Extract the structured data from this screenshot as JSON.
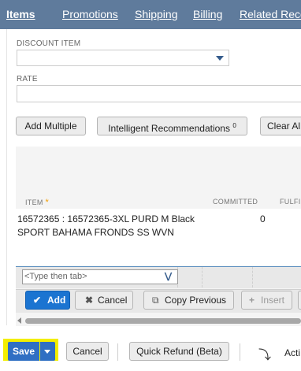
{
  "tabs": [
    {
      "label": "Items",
      "active": true
    },
    {
      "label": "Promotions",
      "active": false
    },
    {
      "label": "Shipping",
      "active": false
    },
    {
      "label": "Billing",
      "active": false
    },
    {
      "label": "Related Reco",
      "active": false
    }
  ],
  "form": {
    "discount_item_label": "DISCOUNT ITEM",
    "discount_item_value": "",
    "rate_label": "RATE",
    "rate_value": ""
  },
  "item_buttons": {
    "add_multiple": "Add Multiple",
    "intelligent_recommendations": "Intelligent Recommendations",
    "intelligent_recommendations_badge": "0",
    "clear_all": "Clear Al"
  },
  "columns": {
    "item": "ITEM",
    "committed": "COMMITTED",
    "fulfilled": "FULFI"
  },
  "rows": [
    {
      "item": "16572365 : 16572365-3XL PURD M Black SPORT BAHAMA FRONDS SS WVN",
      "committed": "0"
    }
  ],
  "edit_row": {
    "placeholder": "<Type then tab>"
  },
  "row_actions": {
    "add": "Add",
    "cancel": "Cancel",
    "copy_previous": "Copy Previous",
    "insert": "Insert"
  },
  "footer": {
    "save": "Save",
    "cancel": "Cancel",
    "quick_refund": "Quick Refund (Beta)",
    "actions": "Acti"
  },
  "colors": {
    "tab_bar": "#5f7b9c",
    "primary_button": "#1b74d1",
    "save_highlight": "#f2ee00"
  }
}
